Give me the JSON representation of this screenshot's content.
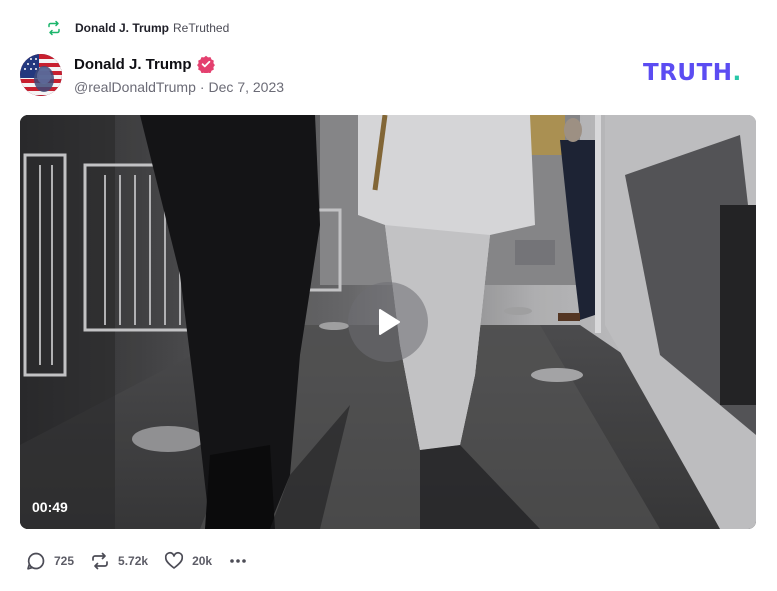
{
  "retruth": {
    "name": "Donald J. Trump",
    "action": "ReTruthed"
  },
  "author": {
    "name": "Donald J. Trump",
    "handle": "@realDonaldTrump",
    "separator": "·",
    "date": "Dec 7, 2023",
    "verified": true
  },
  "brand": {
    "text": "TRUTH",
    "dot": ".",
    "color": "#5b4cf2",
    "dot_color": "#28c7a8"
  },
  "video": {
    "duration": "00:49"
  },
  "actions": {
    "replies": "725",
    "retruths": "5.72k",
    "likes": "20k"
  },
  "icons": {
    "retruth_header": "retruth-icon",
    "verified": "verified-badge-icon",
    "play": "play-icon",
    "reply": "reply-icon",
    "retruth": "retruth-icon",
    "like": "heart-icon",
    "more": "more-icon"
  },
  "colors": {
    "accent": "#5b4cf2",
    "verified": "#e4406f",
    "retruth_green": "#1bb56b"
  }
}
